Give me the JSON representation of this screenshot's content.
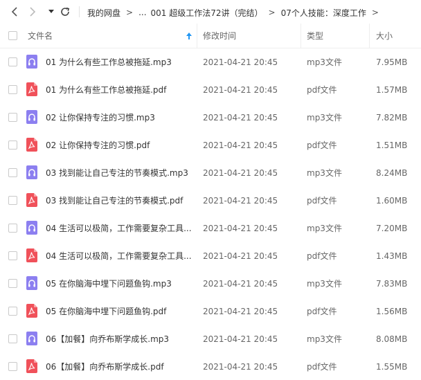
{
  "toolbar": {
    "back_icon": "chevron-left-icon",
    "forward_icon": "chevron-right-icon",
    "dropdown_icon": "triangle-down-icon",
    "refresh_icon": "refresh-icon"
  },
  "breadcrumb": {
    "items": [
      "我的网盘",
      "...",
      "001 超级工作法72讲（完结）",
      "07个人技能：深度工作"
    ],
    "separator": ">"
  },
  "columns": {
    "name": "文件名",
    "modified": "修改时间",
    "type": "类型",
    "size": "大小"
  },
  "colors": {
    "audio_icon": "#8c7ff0",
    "pdf_icon": "#f0515a",
    "sort_arrow": "#2196f3"
  },
  "files": [
    {
      "name": "01 为什么有些工作总被拖延.mp3",
      "modified": "2021-04-21 20:45",
      "type": "mp3文件",
      "size": "7.95MB",
      "icon": "audio-file-icon"
    },
    {
      "name": "01 为什么有些工作总被拖延.pdf",
      "modified": "2021-04-21 20:45",
      "type": "pdf文件",
      "size": "1.57MB",
      "icon": "pdf-file-icon"
    },
    {
      "name": "02 让你保持专注的习惯.mp3",
      "modified": "2021-04-21 20:45",
      "type": "mp3文件",
      "size": "7.82MB",
      "icon": "audio-file-icon"
    },
    {
      "name": "02 让你保持专注的习惯.pdf",
      "modified": "2021-04-21 20:45",
      "type": "pdf文件",
      "size": "1.51MB",
      "icon": "pdf-file-icon"
    },
    {
      "name": "03 找到能让自己专注的节奏模式.mp3",
      "modified": "2021-04-21 20:45",
      "type": "mp3文件",
      "size": "8.24MB",
      "icon": "audio-file-icon"
    },
    {
      "name": "03 找到能让自己专注的节奏模式.pdf",
      "modified": "2021-04-21 20:45",
      "type": "pdf文件",
      "size": "1.60MB",
      "icon": "pdf-file-icon"
    },
    {
      "name": "04 生活可以极简，工作需要复杂工具...",
      "modified": "2021-04-21 20:45",
      "type": "mp3文件",
      "size": "7.20MB",
      "icon": "audio-file-icon"
    },
    {
      "name": "04 生活可以极简，工作需要复杂工具...",
      "modified": "2021-04-21 20:45",
      "type": "pdf文件",
      "size": "1.43MB",
      "icon": "pdf-file-icon"
    },
    {
      "name": "05 在你脑海中埋下问题鱼钩.mp3",
      "modified": "2021-04-21 20:45",
      "type": "mp3文件",
      "size": "7.83MB",
      "icon": "audio-file-icon"
    },
    {
      "name": "05 在你脑海中埋下问题鱼钩.pdf",
      "modified": "2021-04-21 20:45",
      "type": "pdf文件",
      "size": "1.56MB",
      "icon": "pdf-file-icon"
    },
    {
      "name": "06【加餐】向乔布斯学成长.mp3",
      "modified": "2021-04-21 20:45",
      "type": "mp3文件",
      "size": "8.08MB",
      "icon": "audio-file-icon"
    },
    {
      "name": "06【加餐】向乔布斯学成长.pdf",
      "modified": "2021-04-21 20:45",
      "type": "pdf文件",
      "size": "1.55MB",
      "icon": "pdf-file-icon"
    }
  ]
}
